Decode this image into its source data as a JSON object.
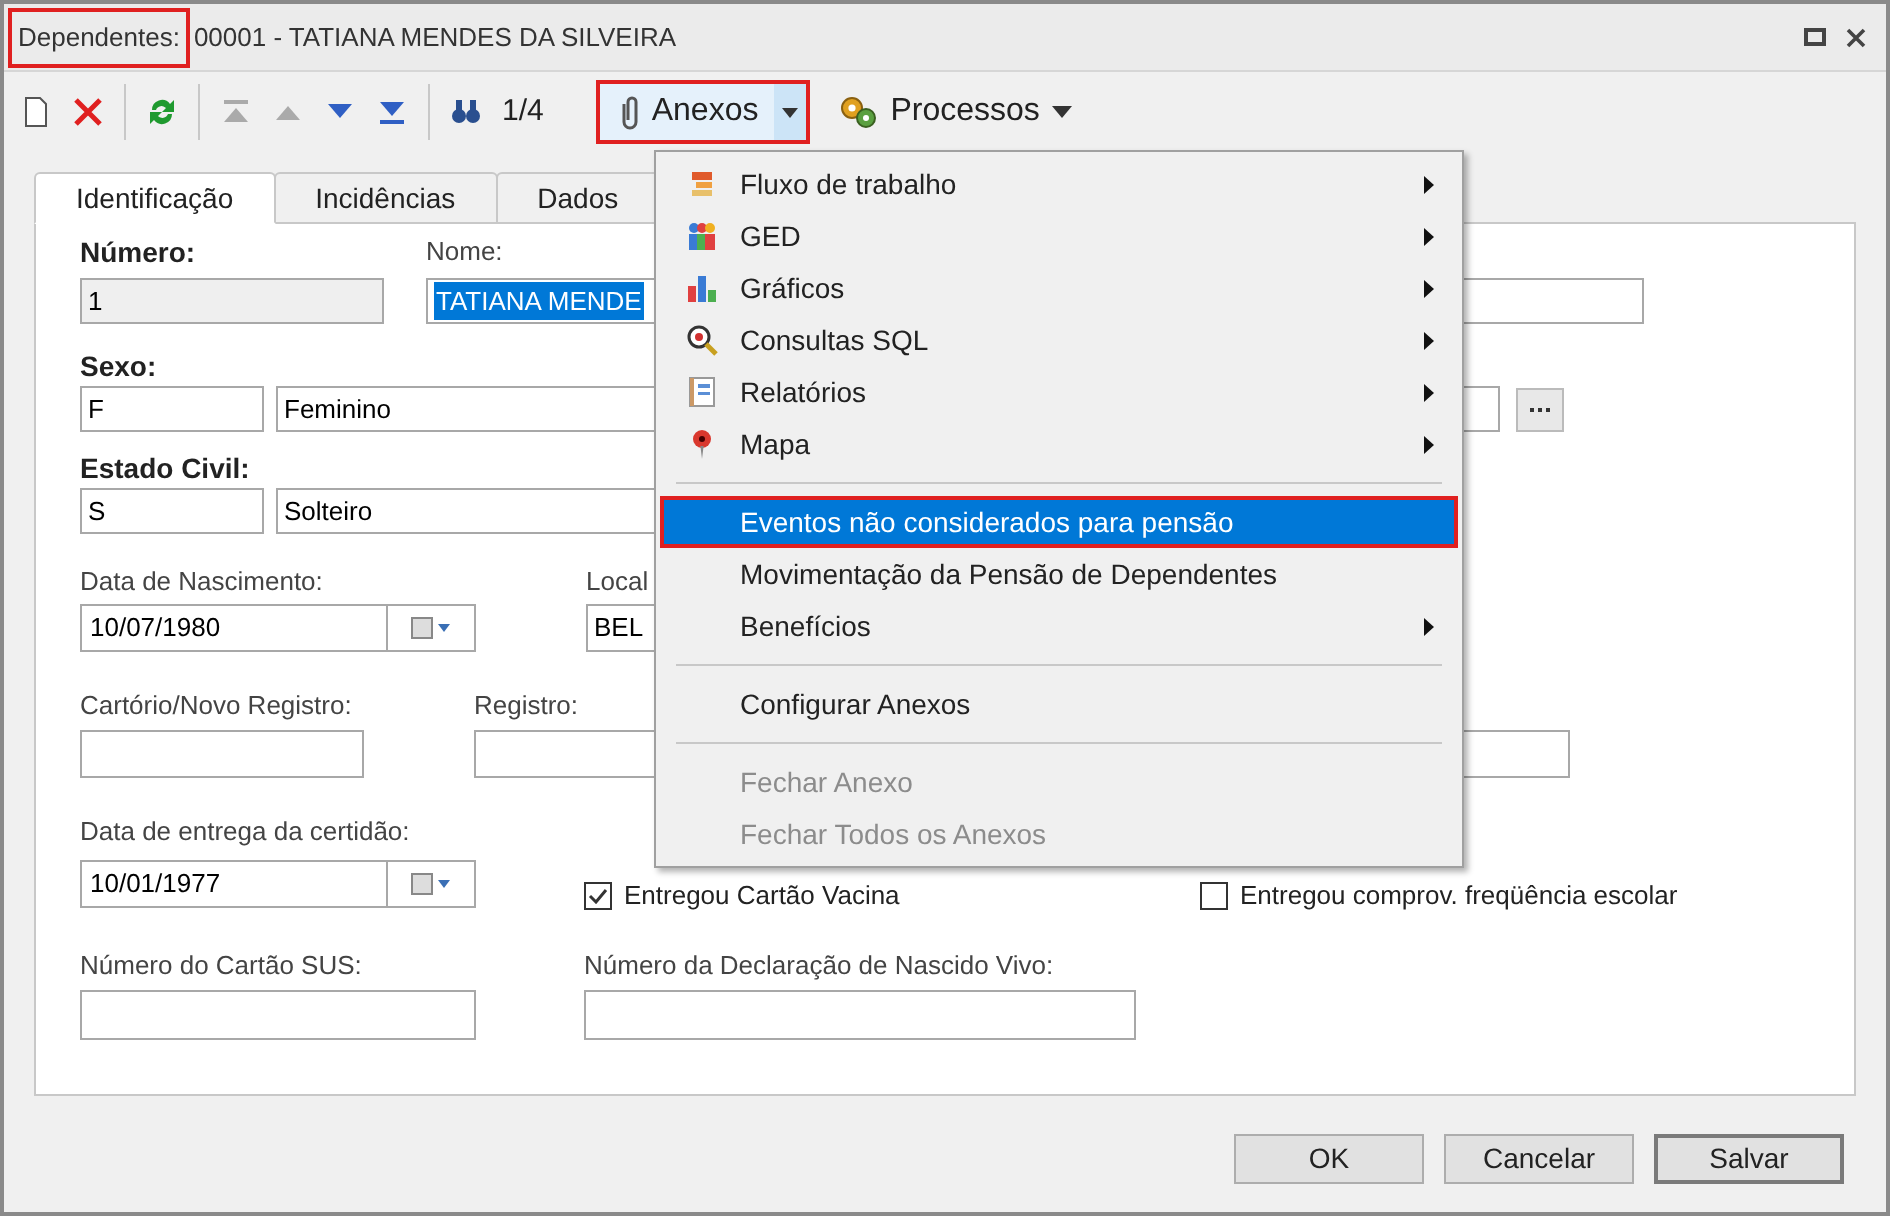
{
  "window": {
    "title_label": "Dependentes:",
    "title_value": "00001 - TATIANA MENDES DA SILVEIRA",
    "title_label_highlighted": true
  },
  "toolbar": {
    "record_counter": "1/4",
    "attachments": {
      "label": "Anexos",
      "highlighted": true,
      "expanded": true
    },
    "processes": {
      "label": "Processos"
    }
  },
  "tabs": [
    {
      "label": "Identificação",
      "selected": true
    },
    {
      "label": "Incidências",
      "selected": false
    },
    {
      "label": "Dados",
      "selected": false
    }
  ],
  "form": {
    "numero": {
      "label": "Número:",
      "value": "1",
      "disabled": true
    },
    "nome": {
      "label": "Nome:",
      "value": "TATIANA MENDE"
    },
    "sexo": {
      "label": "Sexo:",
      "code": "F",
      "description": "Feminino"
    },
    "estado_civil": {
      "label": "Estado Civil:",
      "code": "S",
      "description": "Solteiro"
    },
    "data_nascimento": {
      "label": "Data de Nascimento:",
      "value": "10/07/1980"
    },
    "local": {
      "label": "Local",
      "value": "BEL"
    },
    "cartorio": {
      "label": "Cartório/Novo Registro:"
    },
    "registro": {
      "label": "Registro:"
    },
    "data_entrega": {
      "label": "Data de entrega da certidão:",
      "value": "10/01/1977"
    },
    "checkboxes": [
      {
        "label": "Entregou Cartão Vacina",
        "checked": true
      },
      {
        "label": "Entregou comprov. freqüência escolar",
        "checked": false
      }
    ],
    "cartao_sus": {
      "label": "Número do Cartão SUS:"
    },
    "declaracao": {
      "label": "Número da Declaração de Nascido Vivo:"
    }
  },
  "menu": [
    {
      "kind": "item",
      "label": "Fluxo de trabalho",
      "submenu": true,
      "selected": false,
      "disabled": false,
      "highlighted": false
    },
    {
      "kind": "item",
      "label": "GED",
      "submenu": true,
      "selected": false,
      "disabled": false,
      "highlighted": false
    },
    {
      "kind": "item",
      "label": "Gráficos",
      "submenu": true,
      "selected": false,
      "disabled": false,
      "highlighted": false
    },
    {
      "kind": "item",
      "label": "Consultas SQL",
      "submenu": true,
      "selected": false,
      "disabled": false,
      "highlighted": false
    },
    {
      "kind": "item",
      "label": "Relatórios",
      "submenu": true,
      "selected": false,
      "disabled": false,
      "highlighted": false
    },
    {
      "kind": "item",
      "label": "Mapa",
      "submenu": true,
      "selected": false,
      "disabled": false,
      "highlighted": false
    },
    {
      "kind": "separator"
    },
    {
      "kind": "item",
      "label": "Eventos não considerados para pensão",
      "submenu": false,
      "selected": true,
      "disabled": false,
      "highlighted": true
    },
    {
      "kind": "item",
      "label": "Movimentação da Pensão de Dependentes",
      "submenu": false,
      "selected": false,
      "disabled": false,
      "highlighted": false
    },
    {
      "kind": "item",
      "label": "Benefícios",
      "submenu": true,
      "selected": false,
      "disabled": false,
      "highlighted": false
    },
    {
      "kind": "separator"
    },
    {
      "kind": "item",
      "label": "Configurar Anexos",
      "submenu": false,
      "selected": false,
      "disabled": false,
      "highlighted": false
    },
    {
      "kind": "separator"
    },
    {
      "kind": "item",
      "label": "Fechar Anexo",
      "submenu": false,
      "selected": false,
      "disabled": true,
      "highlighted": false
    },
    {
      "kind": "item",
      "label": "Fechar Todos os Anexos",
      "submenu": false,
      "selected": false,
      "disabled": true,
      "highlighted": false
    }
  ],
  "buttons": [
    {
      "label": "OK",
      "default": false
    },
    {
      "label": "Cancelar",
      "default": false
    },
    {
      "label": "Salvar",
      "default": true
    }
  ]
}
